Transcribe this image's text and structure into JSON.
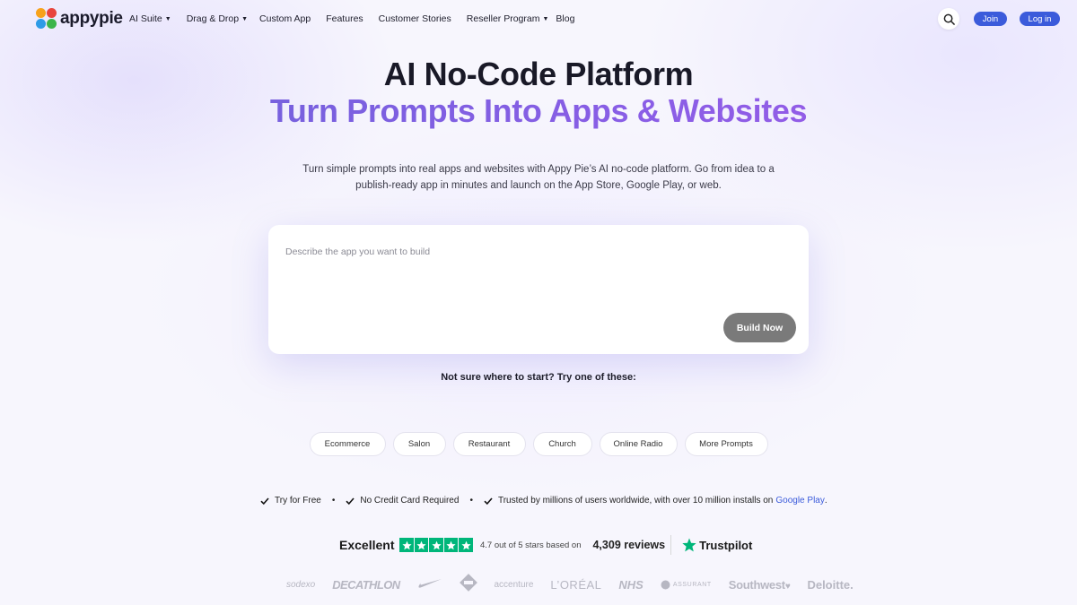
{
  "nav": {
    "brand": "appypie",
    "menu": [
      {
        "label": "AI Suite",
        "dropdown": true
      },
      {
        "label": "Drag & Drop",
        "dropdown": true
      },
      {
        "label": "Custom App",
        "dropdown": false
      },
      {
        "label": "Features",
        "dropdown": false
      },
      {
        "label": "Customer Stories",
        "dropdown": false
      },
      {
        "label": "Reseller Program",
        "dropdown": true
      },
      {
        "label": "Blog",
        "dropdown": false
      }
    ],
    "join_label": "Join",
    "login_label": "Log in",
    "accent_color": "#3b5bdb"
  },
  "hero": {
    "title": "AI No-Code Platform",
    "subtitle": "Turn Prompts Into Apps & Websites",
    "description": "Turn simple prompts into real apps and websites with Appy Pie’s AI no-code platform. Go from idea to a publish-ready app in minutes and launch on the App Store, Google Play, or web."
  },
  "prompt": {
    "placeholder": "Describe the app you want to build",
    "value": "",
    "button_label": "Build Now"
  },
  "suggestions": {
    "heading": "Not sure where to start? Try one of these:",
    "chips": [
      "Ecommerce",
      "Salon",
      "Restaurant",
      "Church",
      "Online Radio",
      "More Prompts"
    ]
  },
  "checks": {
    "items": [
      "Try for Free",
      "No Credit Card Required",
      "Trusted by millions of users worldwide, with over 10 million installs on"
    ],
    "link": "Google Play",
    "suffix": "."
  },
  "trustpilot": {
    "label": "Excellent",
    "stars": 5,
    "rating_text": "4.7 out of 5 stars based on",
    "reviews": "4,309 reviews",
    "brand": "Trustpilot",
    "star_color": "#00b67a"
  },
  "logos": [
    "sodexo",
    "DECATHLON",
    "nike-swoosh",
    "Home Depot",
    "accenture",
    "L’ORÉAL",
    "NHS",
    "ASSURANT",
    "Southwest",
    "Deloitte."
  ]
}
